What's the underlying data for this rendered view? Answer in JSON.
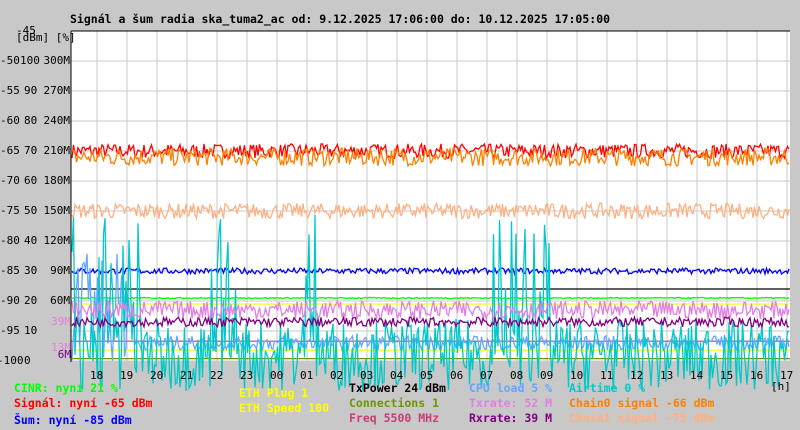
{
  "chart_data": {
    "type": "line",
    "title": "Signál a šum radia ska_tuma2_ac od: 9.12.2025 17:06:00 do: 10.12.2025 17:05:00",
    "xlabel": "[h]",
    "ylabel": "[dBm] [%]",
    "x_ticks": [
      "18",
      "19",
      "20",
      "21",
      "22",
      "23",
      "00",
      "01",
      "02",
      "03",
      "04",
      "05",
      "06",
      "07",
      "08",
      "09",
      "10",
      "11",
      "12",
      "13",
      "14",
      "15",
      "16",
      "17"
    ],
    "y_ticks": [
      {
        "dbm": "-45",
        "pct": "",
        "rate": ""
      },
      {
        "dbm": "-50",
        "pct": "100",
        "rate": "300M"
      },
      {
        "dbm": "-55",
        "pct": "90",
        "rate": "270M"
      },
      {
        "dbm": "-60",
        "pct": "80",
        "rate": "240M"
      },
      {
        "dbm": "-65",
        "pct": "70",
        "rate": "210M"
      },
      {
        "dbm": "-70",
        "pct": "60",
        "rate": "180M"
      },
      {
        "dbm": "-75",
        "pct": "50",
        "rate": "150M"
      },
      {
        "dbm": "-80",
        "pct": "40",
        "rate": "120M"
      },
      {
        "dbm": "-85",
        "pct": "30",
        "rate": "90M"
      },
      {
        "dbm": "-90",
        "pct": "20",
        "rate": "60M"
      },
      {
        "dbm": "-95",
        "pct": "10",
        "rate": ""
      },
      {
        "dbm": "-100",
        "pct": "0",
        "rate": ""
      }
    ],
    "rate_markers": [
      {
        "label": "39M",
        "value": 39,
        "color": "#e080e0"
      },
      {
        "label": "13M",
        "value": 13,
        "color": "#e080e0"
      },
      {
        "label": "6M",
        "value": 6,
        "color": "#800080"
      }
    ],
    "ylim_dbm": [
      -100,
      -45
    ],
    "grid": true,
    "series": [
      {
        "name": "Signal",
        "unit": "dBm",
        "level_dbm": -65,
        "noise": 1.2,
        "color": "#ff0000"
      },
      {
        "name": "Chain0 signal",
        "unit": "dBm",
        "level_dbm": -66,
        "noise": 1.5,
        "color": "#ff8000"
      },
      {
        "name": "Chain1 signal",
        "unit": "dBm",
        "level_dbm": -75,
        "noise": 1.3,
        "color": "#ffb080"
      },
      {
        "name": "Noise",
        "unit": "dBm",
        "level_dbm": -85,
        "noise": 0.5,
        "color": "#0000ff"
      },
      {
        "name": "CINR",
        "unit": "%",
        "level_dbm": -89.5,
        "noise": 0.1,
        "color": "#00ff00"
      },
      {
        "name": "CPU load",
        "unit": "%",
        "level_dbm": -97,
        "noise": 1.2,
        "color": "#60a8ff"
      },
      {
        "name": "Airtime",
        "unit": "%",
        "level_dbm": -99,
        "noise": 6,
        "color": "#00c8c8"
      },
      {
        "name": "Txrate",
        "unit": "M",
        "level_dbm": -91.5,
        "noise": 1.5,
        "color": "#e080e0"
      },
      {
        "name": "Rxrate",
        "unit": "M",
        "level_dbm": -93.5,
        "noise": 0.8,
        "color": "#800080"
      }
    ],
    "ref_lines": [
      {
        "name": "TxPower",
        "level_dbm": -88,
        "color": "#000000"
      },
      {
        "name": "ETH Plug",
        "level_dbm": -90.5,
        "color": "#ffff00"
      },
      {
        "name": "Freq",
        "level_dbm": -96.7,
        "color": "#c83c78"
      },
      {
        "name": "ETH Speed",
        "level_dbm": -98.2,
        "color": "#ffff00"
      },
      {
        "name": "Connections",
        "level_dbm": -99.6,
        "color": "#6e9600"
      }
    ]
  },
  "legend": {
    "cinr": "CINR: nyní 21 %",
    "signal": "Signál: nyní -65 dBm",
    "noise": "Šum: nyní -85 dBm",
    "eth_plug": "ETH Plug 1",
    "eth_speed": "ETH Speed 100",
    "txpower": "TxPower 24 dBm",
    "connections": "Connections 1",
    "freq": "Freq 5500 MHz",
    "cpu": "CPU load 5 %",
    "txrate": "Txrate: 52 M",
    "rxrate": "Rxrate: 39 M",
    "airtime": "Airtime 0 %",
    "chain0": "Chain0 signal -66 dBm",
    "chain1": "Chain1 signal -75 dBm"
  }
}
